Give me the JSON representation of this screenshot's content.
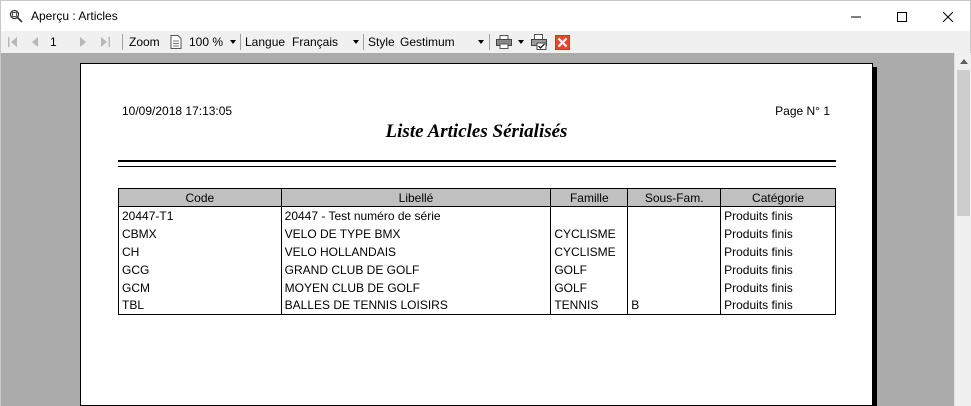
{
  "window": {
    "title": "Aperçu : Articles"
  },
  "toolbar": {
    "page_value": "1",
    "zoom_label": "Zoom",
    "zoom_value": "100 %",
    "language_label": "Langue",
    "language_value": "Français",
    "style_label": "Style",
    "style_value": "Gestimum"
  },
  "report": {
    "datetime": "10/09/2018 17:13:05",
    "page_label": "Page N° 1",
    "title": "Liste Articles Sérialisés",
    "columns": [
      "Code",
      "Libellé",
      "Famille",
      "Sous-Fam.",
      "Catégorie"
    ],
    "rows": [
      [
        "20447-T1",
        "20447 - Test numéro de série",
        "",
        "",
        "Produits finis"
      ],
      [
        "CBMX",
        "VELO DE TYPE BMX",
        "CYCLISME",
        "",
        "Produits finis"
      ],
      [
        "CH",
        "VELO HOLLANDAIS",
        "CYCLISME",
        "",
        "Produits finis"
      ],
      [
        "GCG",
        "GRAND CLUB DE GOLF",
        "GOLF",
        "",
        "Produits finis"
      ],
      [
        "GCM",
        "MOYEN CLUB DE GOLF",
        "GOLF",
        "",
        "Produits finis"
      ],
      [
        "TBL",
        "BALLES DE TENNIS LOISIRS",
        "TENNIS",
        "B",
        "Produits finis"
      ]
    ]
  },
  "colors": {
    "close_button": "#e8452c",
    "header_fill": "#c0c0c0",
    "preview_bg": "#ababab"
  },
  "icons": [
    "preview-icon",
    "first-page-icon",
    "previous-page-icon",
    "next-page-icon",
    "last-page-icon",
    "page-icon",
    "printer-icon",
    "print-setup-icon",
    "close-red-icon"
  ]
}
